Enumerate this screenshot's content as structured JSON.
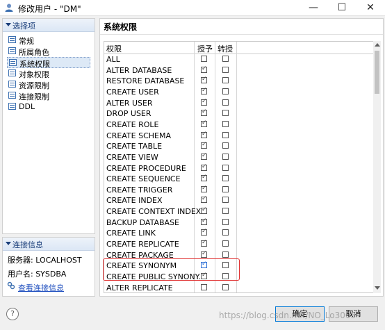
{
  "window": {
    "title": "修改用户 - \"DM\"",
    "minimize": "—",
    "maximize": "☐",
    "close": "✕"
  },
  "left_nav": {
    "header": "选择项",
    "items": [
      {
        "label": "常规",
        "selected": false
      },
      {
        "label": "所属角色",
        "selected": false
      },
      {
        "label": "系统权限",
        "selected": true
      },
      {
        "label": "对象权限",
        "selected": false
      },
      {
        "label": "资源限制",
        "selected": false
      },
      {
        "label": "连接限制",
        "selected": false
      },
      {
        "label": "DDL",
        "selected": false
      }
    ]
  },
  "conn_info": {
    "header": "连接信息",
    "server": "服务器: LOCALHOST",
    "user": "用户名: SYSDBA",
    "view_link": "查看连接信息"
  },
  "main": {
    "title": "系统权限",
    "columns": [
      "权限",
      "授予",
      "转授"
    ],
    "rows": [
      {
        "name": "ALL",
        "grant": false,
        "transfer": false
      },
      {
        "name": "ALTER DATABASE",
        "grant": true,
        "transfer": false
      },
      {
        "name": "RESTORE DATABASE",
        "grant": true,
        "transfer": false
      },
      {
        "name": "CREATE USER",
        "grant": true,
        "transfer": false
      },
      {
        "name": "ALTER USER",
        "grant": true,
        "transfer": false
      },
      {
        "name": "DROP USER",
        "grant": true,
        "transfer": false
      },
      {
        "name": "CREATE ROLE",
        "grant": true,
        "transfer": false
      },
      {
        "name": "CREATE SCHEMA",
        "grant": true,
        "transfer": false
      },
      {
        "name": "CREATE TABLE",
        "grant": true,
        "transfer": false
      },
      {
        "name": "CREATE VIEW",
        "grant": true,
        "transfer": false
      },
      {
        "name": "CREATE PROCEDURE",
        "grant": true,
        "transfer": false
      },
      {
        "name": "CREATE SEQUENCE",
        "grant": true,
        "transfer": false
      },
      {
        "name": "CREATE TRIGGER",
        "grant": true,
        "transfer": false
      },
      {
        "name": "CREATE INDEX",
        "grant": true,
        "transfer": false
      },
      {
        "name": "CREATE CONTEXT INDEX",
        "grant": true,
        "transfer": false
      },
      {
        "name": "BACKUP DATABASE",
        "grant": true,
        "transfer": false
      },
      {
        "name": "CREATE LINK",
        "grant": true,
        "transfer": false
      },
      {
        "name": "CREATE REPLICATE",
        "grant": true,
        "transfer": false
      },
      {
        "name": "CREATE PACKAGE",
        "grant": true,
        "transfer": false
      },
      {
        "name": "CREATE SYNONYM",
        "grant": true,
        "transfer": false,
        "focused": true
      },
      {
        "name": "CREATE PUBLIC SYNONY.",
        "grant": true,
        "transfer": false
      },
      {
        "name": "ALTER REPLICATE",
        "grant": false,
        "transfer": false
      }
    ]
  },
  "footer": {
    "help": "?",
    "ok": "确定",
    "cancel": "取消"
  },
  "watermark": "https://blog.csdn.net/NO_Lo3003",
  "colors": {
    "accent": "#0078d7",
    "highlight": "#e03030",
    "link": "#1f4fbf"
  }
}
